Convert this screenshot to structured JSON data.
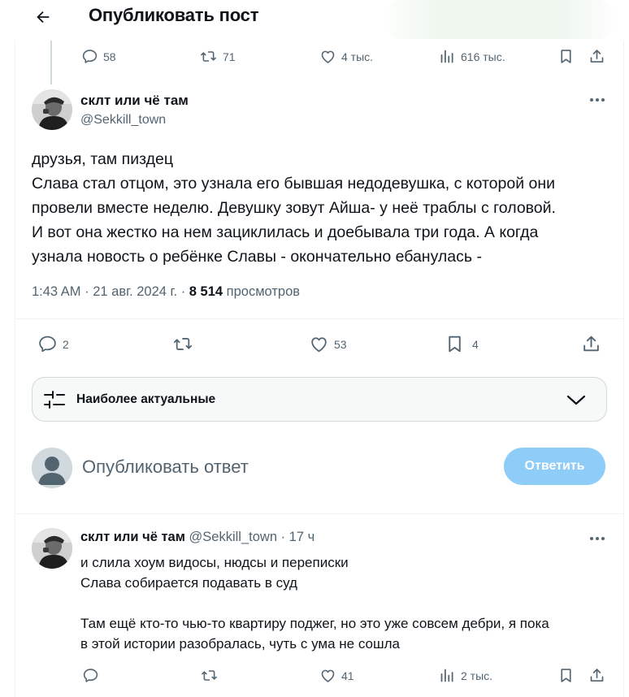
{
  "header": {
    "title": "Опубликовать пост",
    "back_icon": "arrow-left-icon"
  },
  "parent_actions": {
    "replies": "58",
    "reposts": "71",
    "likes": "4 тыс.",
    "views": "616 тыс."
  },
  "tweet": {
    "author_name": "склт или чё там",
    "author_handle": "@Sekkill_town",
    "lines": [
      "друзья, там пиздец",
      "Слава стал отцом, это узнала его бывшая недодевушка, с которой они",
      "провели вместе неделю. Девушку зовут Айша- у неё траблы с головой.",
      "И вот она жестко на нем зациклилась и доебывала три года. А когда",
      "узнала новость о ребёнке Славы - окончательно ебанулась -"
    ],
    "time": "1:43 AM · 21 авг. 2024 г. · ",
    "views_count": "8 514",
    "views_label": " просмотров",
    "actions": {
      "replies": "2",
      "likes": "53",
      "bookmarks": "4"
    }
  },
  "filter": {
    "label": "Наиболее актуальные"
  },
  "composer": {
    "placeholder": "Опубликовать ответ",
    "button": "Ответить"
  },
  "reply": {
    "author_name": "склт или чё там",
    "author_handle": "@Sekkill_town",
    "time": " · 17 ч",
    "paragraphs": [
      "и слила хоум видосы, нюдсы и переписки",
      "Слава собирается подавать в суд",
      "",
      "Там ещё кто-то чью-то квартиру поджег, но это уже совсем дебри, я пока",
      "в этой истории разобралась, чуть с ума не сошла"
    ],
    "actions": {
      "likes": "41",
      "views": "2 тыс."
    }
  },
  "colors": {
    "text_primary": "#0f1419",
    "text_secondary": "#536471",
    "accent_disabled": "#8ecdf8",
    "border": "#cfd9de"
  }
}
